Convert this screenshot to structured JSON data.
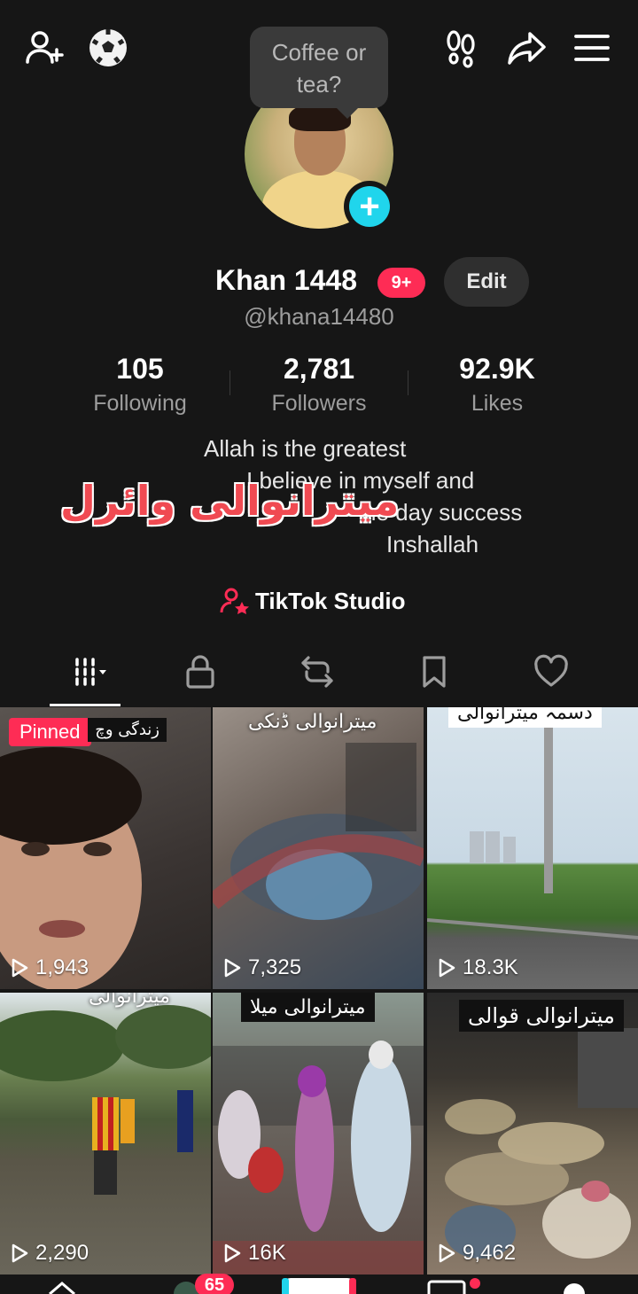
{
  "tooltip": {
    "text_line1": "Coffee or",
    "text_line2": "tea?"
  },
  "profile": {
    "name": "Khan 1448",
    "notification_badge": "9+",
    "edit_label": "Edit",
    "handle": "@khana14480"
  },
  "stats": [
    {
      "value": "105",
      "label": "Following"
    },
    {
      "value": "2,781",
      "label": "Followers"
    },
    {
      "value": "92.9K",
      "label": "Likes"
    }
  ],
  "bio": {
    "line1": "Allah is the greatest",
    "line2": "I believe in myself and",
    "line3": "ne day success",
    "line4": "Inshallah"
  },
  "overlay_text": "میترانوالی وائرل",
  "studio_label": "TikTok Studio",
  "videos": [
    {
      "views": "1,943",
      "caption": "زندگی وچ",
      "pinned_label": "Pinned"
    },
    {
      "views": "7,325",
      "caption": "میترانوالی ڈنکی"
    },
    {
      "views": "18.3K",
      "caption": "دسمہ میترانوالی"
    },
    {
      "views": "2,290",
      "caption": "میترانوالی"
    },
    {
      "views": "16K",
      "caption": "میترانوالی میلا"
    },
    {
      "views": "9,462",
      "caption": "میترانوالی قوالی"
    }
  ],
  "bottom_nav": {
    "inbox_badge": "65"
  },
  "colors": {
    "accent": "#fe2c55",
    "plus": "#20d5ec",
    "background": "#161616"
  }
}
